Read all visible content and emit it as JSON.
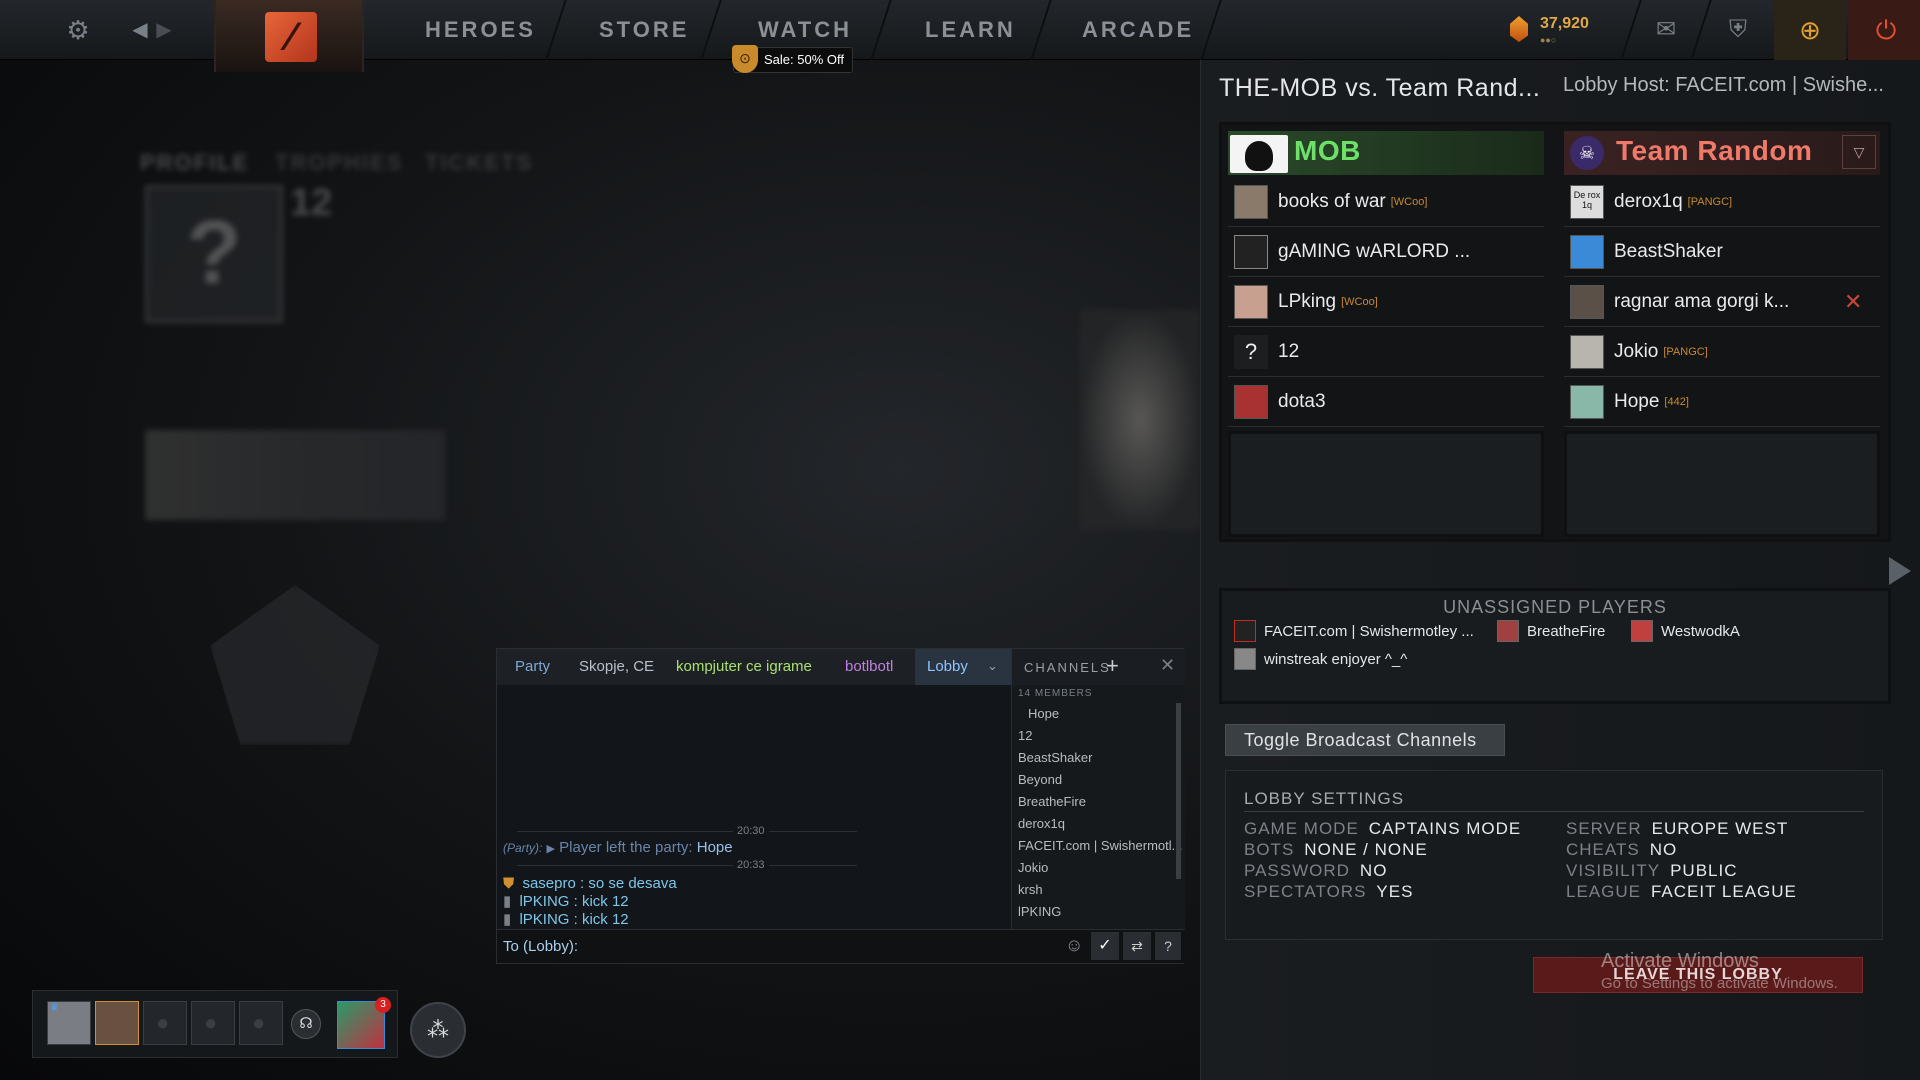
{
  "nav": {
    "tabs": [
      "HEROES",
      "STORE",
      "WATCH",
      "LEARN",
      "ARCADE"
    ],
    "sale_badge": "Sale: 50% Off",
    "shards": "37,920"
  },
  "lobby": {
    "title": "THE-MOB vs. Team Rand...",
    "host": "Lobby Host: FACEIT.com | Swishe...",
    "radiant": {
      "name": "MOB",
      "players": [
        {
          "name": "books of war",
          "tag": "[WCoo]"
        },
        {
          "name": "gAMING wARLORD ...",
          "tag": ""
        },
        {
          "name": "LPking",
          "tag": "[WCoo]"
        },
        {
          "name": "12",
          "tag": ""
        },
        {
          "name": "dota3",
          "tag": ""
        }
      ]
    },
    "dire": {
      "name": "Team Random",
      "players": [
        {
          "name": "derox1q",
          "tag": "[PANGC]"
        },
        {
          "name": "BeastShaker",
          "tag": ""
        },
        {
          "name": "ragnar ama gorgi k...",
          "tag": ""
        },
        {
          "name": "Jokio",
          "tag": "[PANGC]"
        },
        {
          "name": "Hope",
          "tag": "[442]"
        }
      ]
    },
    "unassigned_title": "UNASSIGNED PLAYERS",
    "unassigned": [
      "FACEIT.com | Swishermotley ...",
      "BreatheFire",
      "WestwodkA",
      "winstreak enjoyer ^_^"
    ],
    "toggle_button": "Toggle Broadcast Channels",
    "settings_title": "LOBBY SETTINGS",
    "settings_left": [
      {
        "label": "GAME MODE",
        "value": "CAPTAINS MODE"
      },
      {
        "label": "BOTS",
        "value": "NONE / NONE"
      },
      {
        "label": "PASSWORD",
        "value": "NO"
      },
      {
        "label": "SPECTATORS",
        "value": "YES"
      }
    ],
    "settings_right": [
      {
        "label": "SERVER",
        "value": "EUROPE WEST"
      },
      {
        "label": "CHEATS",
        "value": "NO"
      },
      {
        "label": "VISIBILITY",
        "value": "PUBLIC"
      },
      {
        "label": "LEAGUE",
        "value": "FACEIT LEAGUE"
      }
    ],
    "leave_button": "LEAVE THIS LOBBY"
  },
  "watermark": {
    "line1": "Activate Windows",
    "line2": "Go to Settings to activate Windows."
  },
  "chat": {
    "tabs": [
      {
        "label": "Party",
        "color": "#7ea7d8"
      },
      {
        "label": "Skopje, CE",
        "color": "#b8c0c8"
      },
      {
        "label": "kompjuter ce igrame",
        "color": "#a8e070"
      },
      {
        "label": "botlbotl",
        "color": "#c080e0"
      },
      {
        "label": "Lobby",
        "color": "#8ec5ff"
      }
    ],
    "channels_label": "CHANNELS",
    "members_count": "14 MEMBERS",
    "members": [
      "Hope",
      "12",
      "BeastShaker",
      "Beyond",
      "BreatheFire",
      "derox1q",
      "FACEIT.com | Swishermotl...",
      "Jokio",
      "krsh",
      "lPKING"
    ],
    "time1": "20:30",
    "time2": "20:33",
    "system_prefix": "(Party):",
    "system_text": "Player left the party:",
    "system_name": "Hope",
    "messages": [
      {
        "user": "sasepro",
        "text": ": so se desava"
      },
      {
        "user": "lPKING",
        "text": ": kick 12"
      },
      {
        "user": "lPKING",
        "text": ": kick 12"
      }
    ],
    "input_label": "To (Lobby):"
  },
  "party": {
    "notification_count": "3"
  },
  "background": {
    "profile": "PROFILE",
    "trophies": "TROPHIES",
    "tickets": "TICKETS",
    "friends": "12"
  }
}
